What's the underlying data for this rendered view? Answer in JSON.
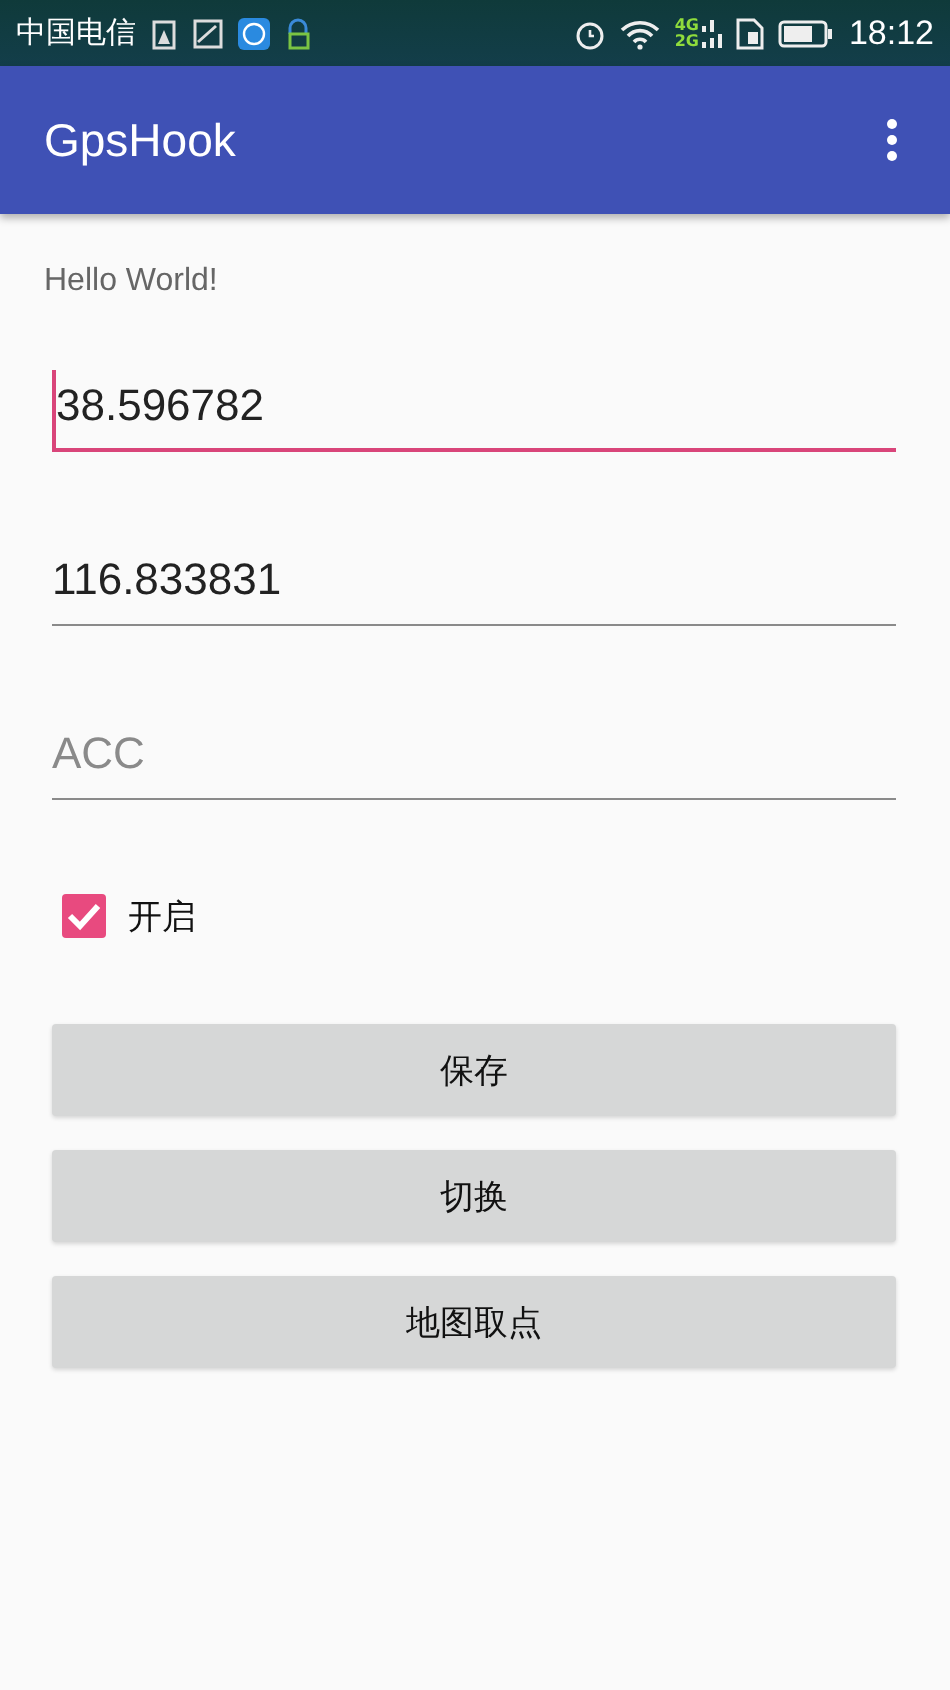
{
  "status_bar": {
    "carrier": "中国电信",
    "network_labels": [
      "4G",
      "2G"
    ],
    "time": "18:12"
  },
  "app_bar": {
    "title": "GpsHook"
  },
  "greeting": "Hello World!",
  "fields": [
    {
      "value": "38.596782",
      "focused": true
    },
    {
      "value": "116.833831",
      "focused": false
    },
    {
      "placeholder": "ACC",
      "focused": false
    }
  ],
  "checkbox": {
    "label": "开启",
    "checked": true
  },
  "buttons": [
    "保存",
    "切换",
    "地图取点"
  ]
}
